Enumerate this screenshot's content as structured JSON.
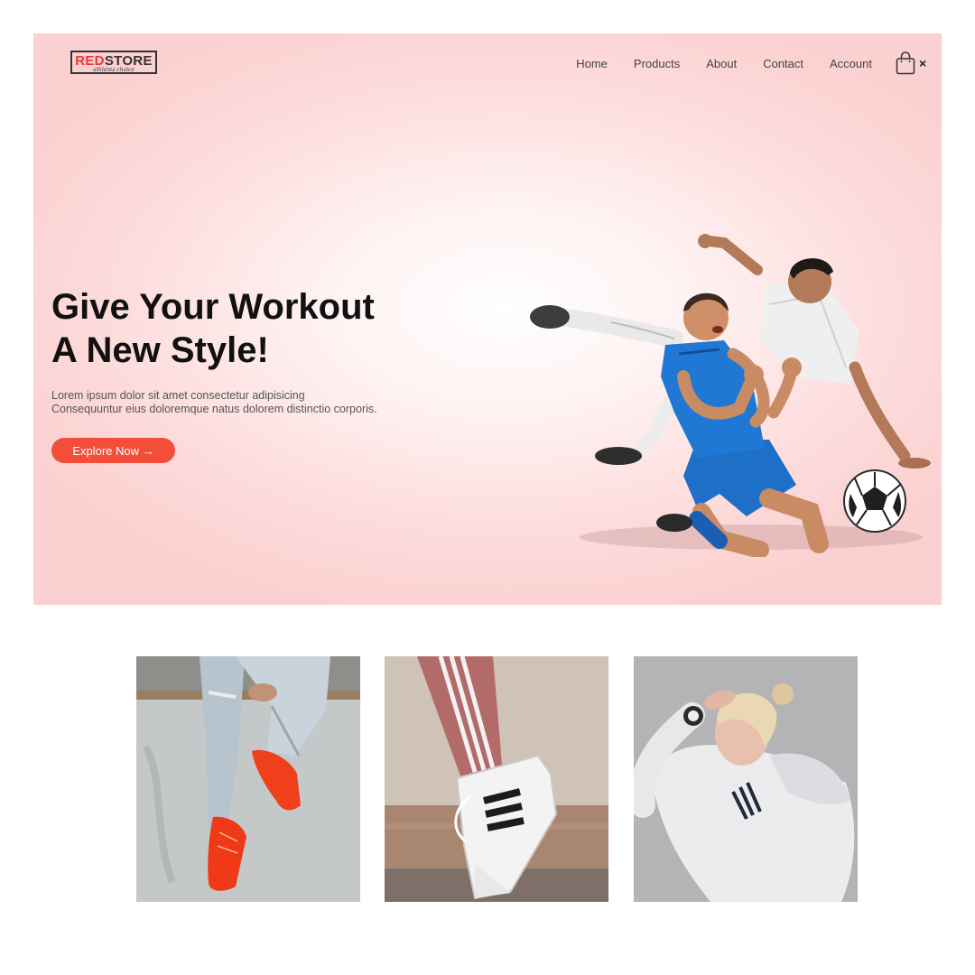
{
  "brand": {
    "name_red": "RED",
    "name_dark": "STORE",
    "tagline": "athletes choice"
  },
  "nav": {
    "items": [
      {
        "label": "Home"
      },
      {
        "label": "Products"
      },
      {
        "label": "About"
      },
      {
        "label": "Contact"
      },
      {
        "label": "Account"
      }
    ],
    "cart_icon": "shopping-bag-icon",
    "close_icon": "close-icon",
    "close_glyph": "×"
  },
  "hero": {
    "title_line1": "Give Your Workout",
    "title_line2": "A New Style!",
    "text_line1": "Lorem ipsum dolor sit amet consectetur adipisicing",
    "text_line2": "Consequuntur eius doloremque natus dolorem distinctio corporis.",
    "cta_label": "Explore Now →",
    "accent": "#f24e3a",
    "image": "football-players-image"
  },
  "categories": [
    {
      "image": "orange-sneakers-image"
    },
    {
      "image": "striped-sneaker-image"
    },
    {
      "image": "white-hoodie-woman-image"
    }
  ],
  "colors": {
    "brand_red": "#e33a36",
    "hero_bg": "#fbd4d4"
  }
}
